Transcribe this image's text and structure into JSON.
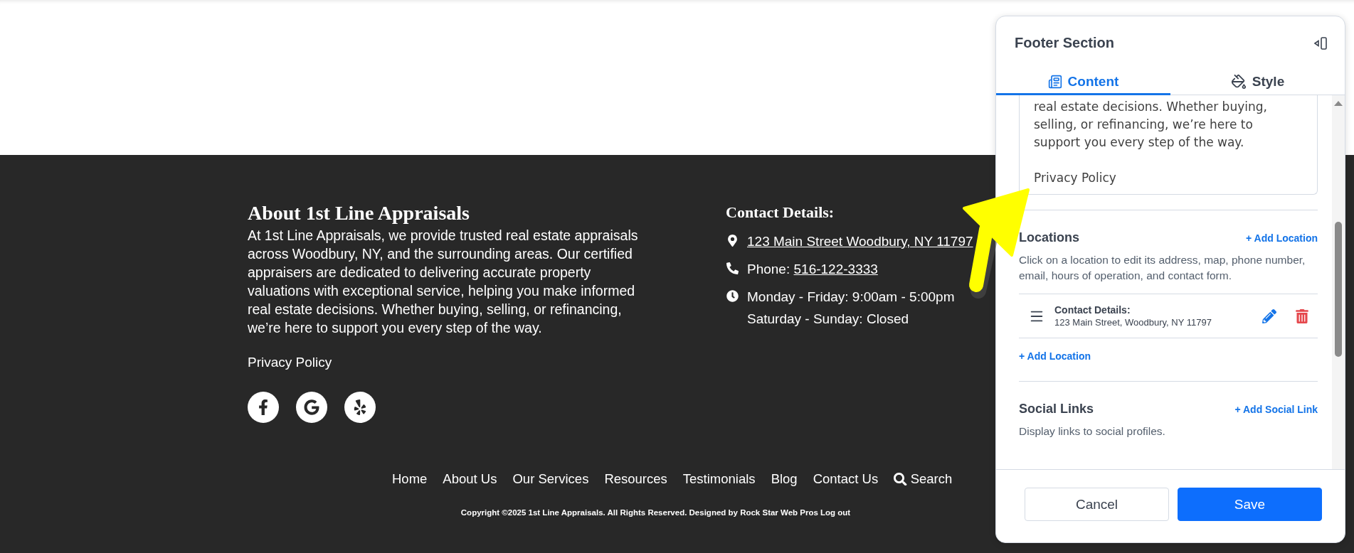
{
  "footer": {
    "about": {
      "title": "About 1st Line Appraisals",
      "text": "At 1st Line Appraisals, we provide trusted real estate appraisals across Woodbury, NY, and the surrounding areas. Our certified appraisers are dedicated to delivering accurate property valuations with exceptional service, helping you make informed real estate decisions. Whether buying, selling, or refinancing, we’re here to support you every step of the way.",
      "link": "Privacy Policy"
    },
    "social": [
      {
        "kind": "facebook"
      },
      {
        "kind": "google"
      },
      {
        "kind": "yelp"
      }
    ],
    "contact": {
      "title": "Contact Details:",
      "items": [
        {
          "kind": "address",
          "lines": [
            "123 Main Street Woodbury, NY 11797"
          ]
        },
        {
          "kind": "phone",
          "label": "Phone:",
          "lines": [
            "516-122-3333"
          ]
        },
        {
          "kind": "hours",
          "lines": [
            "Monday - Friday: 9:00am - 5:00pm",
            "Saturday - Sunday: Closed"
          ]
        }
      ]
    },
    "nav": [
      {
        "kind": "link",
        "label": "Home"
      },
      {
        "kind": "link",
        "label": "About Us"
      },
      {
        "kind": "link",
        "label": "Our Services"
      },
      {
        "kind": "link",
        "label": "Resources"
      },
      {
        "kind": "link",
        "label": "Testimonials"
      },
      {
        "kind": "link",
        "label": "Blog"
      },
      {
        "kind": "link",
        "label": "Contact Us"
      },
      {
        "kind": "search",
        "label": "Search"
      }
    ],
    "copyright": "Copyright ©2025 1st Line Appraisals. All Rights Reserved. Designed by Rock Star Web Pros Log out"
  },
  "panel": {
    "title": "Footer Section",
    "tabs": [
      {
        "kind": "content",
        "label": "Content",
        "selected": true
      },
      {
        "kind": "style",
        "label": "Style",
        "selected": false
      }
    ],
    "editor": {
      "paragraphs": [
        "real estate decisions. Whether buying, selling, or refinancing, we’re here to support you every step of the way.",
        "Privacy Policy"
      ]
    },
    "locations": {
      "title": "Locations",
      "add": "+ Add Location",
      "description": "Click on a location to edit its address, map, phone number, email, hours of operation, and contact form.",
      "items": [
        {
          "name": "Contact Details:",
          "address": "123 Main Street, Woodbury, NY 11797"
        }
      ],
      "add_bottom": "+ Add Location"
    },
    "social_links": {
      "title": "Social Links",
      "add": "+ Add Social Link",
      "description": "Display links to social profiles."
    },
    "buttons": {
      "cancel": "Cancel",
      "save": "Save"
    }
  }
}
